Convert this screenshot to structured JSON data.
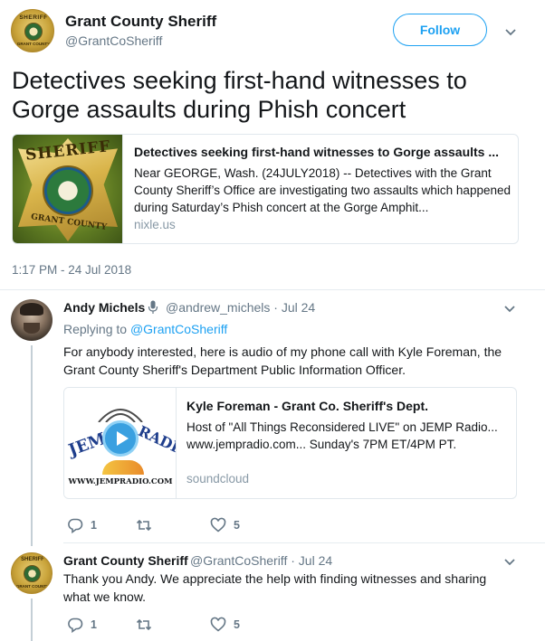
{
  "main_tweet": {
    "author_name": "Grant County Sheriff",
    "author_handle": "@GrantCoSheriff",
    "follow_label": "Follow",
    "text": "Detectives seeking first-hand witnesses to Gorge assaults during Phish concert",
    "timestamp": "1:17 PM - 24 Jul 2018",
    "avatar_text_top": "SHERIFF",
    "avatar_text_bottom": "GRANT COUNTY",
    "card": {
      "image_text_top": "SHERIFF",
      "image_text_bottom": "GRANT COUNTY",
      "title": "Detectives seeking first-hand witnesses to Gorge assaults ...",
      "description": "Near GEORGE, Wash. (24JULY2018) -- Detectives with the Grant County Sheriff’s Office are investigating two assaults which happened during Saturday’s Phish concert at the Gorge Amphit...",
      "domain": "nixle.us"
    }
  },
  "replies": [
    {
      "author_name": "Andy Michels",
      "author_handle": "@andrew_michels",
      "date": "· Jul 24",
      "replying_prefix": "Replying to",
      "replying_to": "@GrantCoSheriff",
      "text": "For anybody interested, here is audio of my phone call with Kyle Foreman, the Grant County Sheriff's Department Public Information Officer.",
      "card": {
        "image_text_left": "JEMP",
        "image_text_right": "RADIO",
        "image_url_text": "WWW.JEMPRADIO.COM",
        "title": "Kyle Foreman - Grant Co. Sheriff's Dept.",
        "description": "Host of \"All Things Reconsidered LIVE\" on JEMP Radio... www.jempradio.com... Sunday's 7PM ET/4PM PT.",
        "domain": "soundcloud"
      },
      "actions": {
        "replies": "1",
        "retweets": "",
        "likes": "5"
      }
    },
    {
      "author_name": "Grant County Sheriff",
      "author_handle": "@GrantCoSheriff",
      "date": "· Jul 24",
      "avatar_text_top": "SHERIFF",
      "avatar_text_bottom": "GRANT COUNTY",
      "text": "Thank you Andy. We appreciate the help with finding witnesses and sharing what we know.",
      "actions": {
        "replies": "1",
        "retweets": "",
        "likes": "5"
      }
    }
  ],
  "colors": {
    "accent": "#1da1f2",
    "secondary_text": "#657786",
    "border": "#e1e8ed",
    "thread_line": "#c4cfd6"
  },
  "icons": [
    "chevron-down-icon",
    "microphone-icon",
    "reply-icon",
    "retweet-icon",
    "heart-icon",
    "play-icon"
  ]
}
